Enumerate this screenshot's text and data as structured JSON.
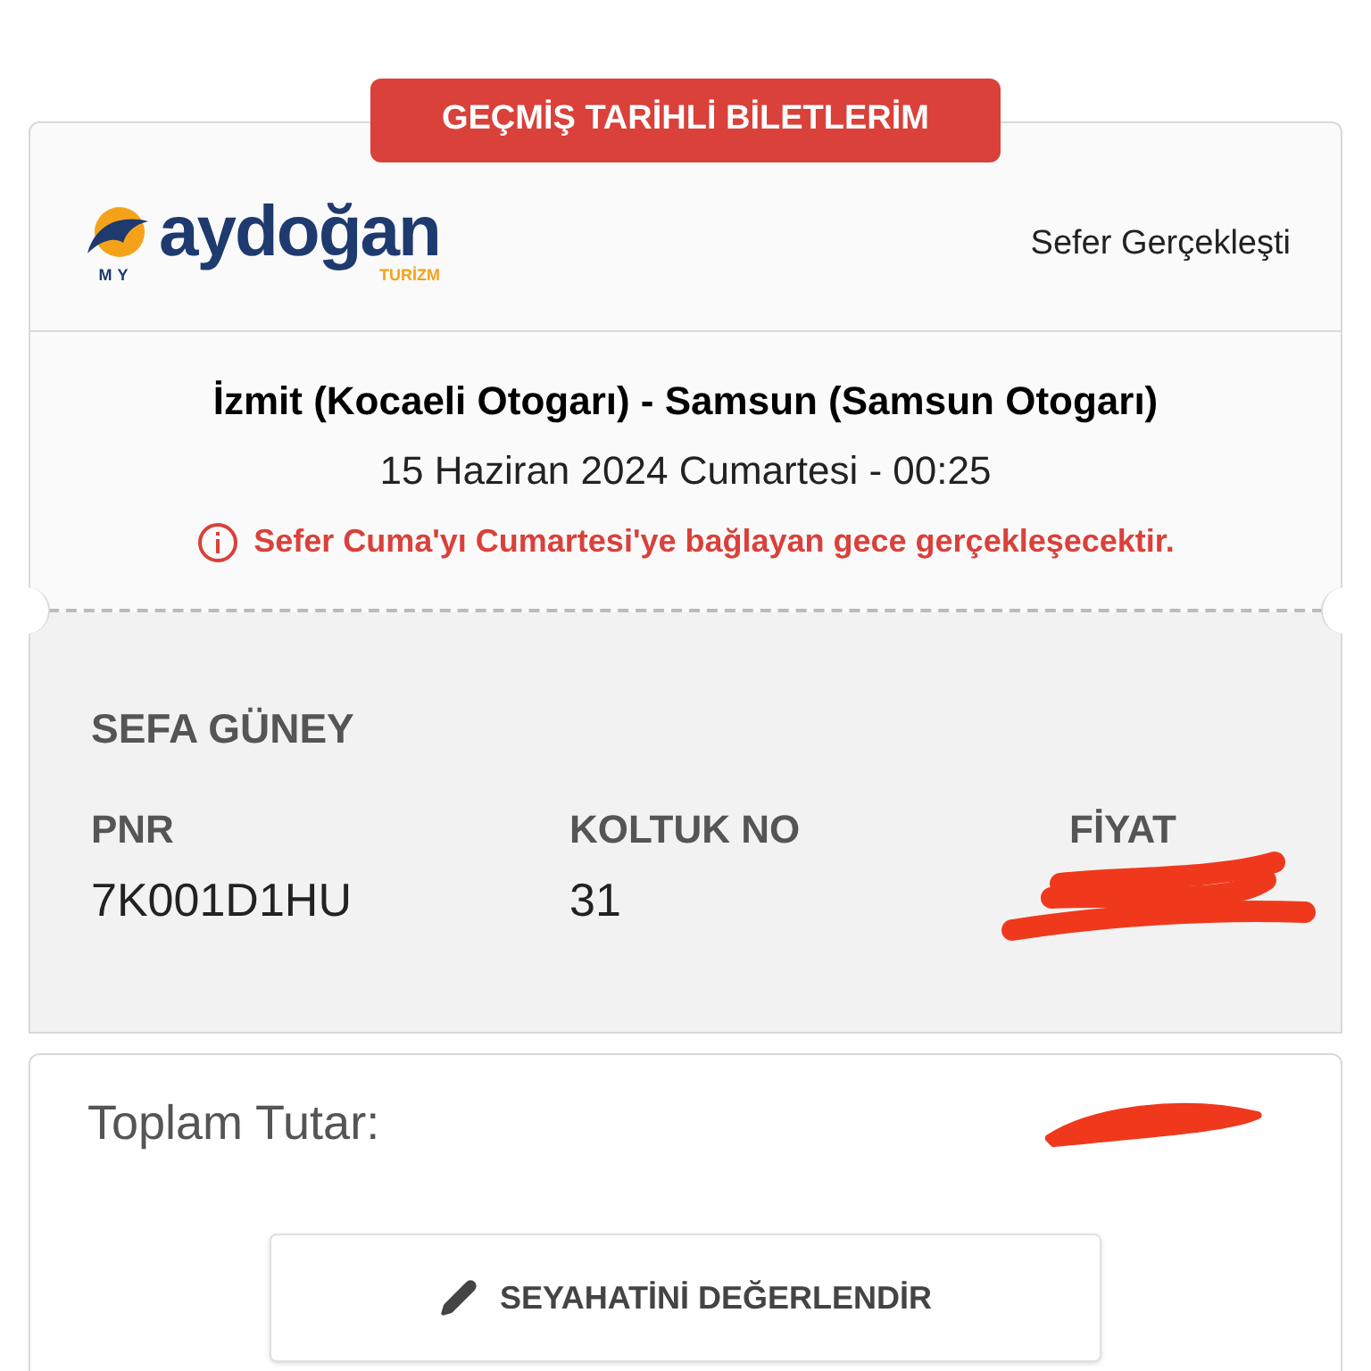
{
  "badge": "GEÇMİŞ TARİHLİ BİLETLERİM",
  "logo": {
    "prefix": "MY",
    "name": "aydoğan",
    "tagline": "TURİZM"
  },
  "status": "Sefer Gerçekleşti",
  "route": "İzmit (Kocaeli Otogarı) - Samsun (Samsun Otogarı)",
  "date": "15 Haziran 2024 Cumartesi - 00:25",
  "warning": "Sefer Cuma'yı Cumartesi'ye bağlayan gece gerçekleşecektir.",
  "passenger": "SEFA GÜNEY",
  "fields": [
    {
      "label": "PNR",
      "value": "7K001D1HU",
      "redacted": false
    },
    {
      "label": "KOLTUK NO",
      "value": "31",
      "redacted": false
    },
    {
      "label": "FİYAT",
      "redacted": true
    }
  ],
  "total": {
    "label": "Toplam Tutar:",
    "redacted": true
  },
  "rate_button": "SEYAHATİNİ DEĞERLENDİR"
}
